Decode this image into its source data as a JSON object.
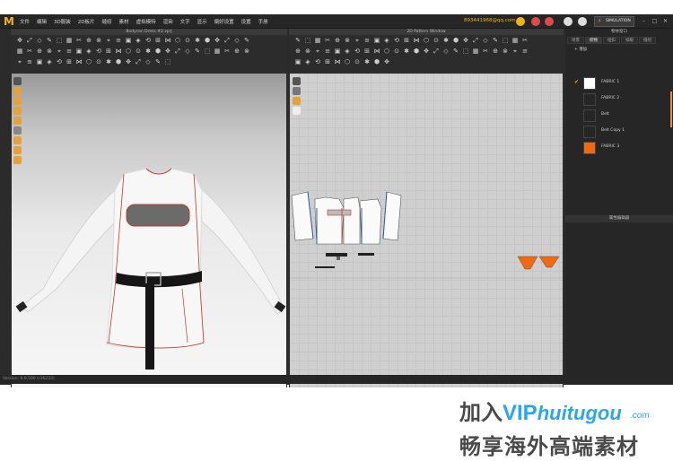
{
  "app": {
    "logo": "M",
    "menu": [
      "文件",
      "编辑",
      "3D服装",
      "2D板片",
      "缝纫",
      "素材",
      "虚拟模特",
      "渲染",
      "文字",
      "显示",
      "偏好设置",
      "设置",
      "手册"
    ],
    "account": "893441968@qq.com",
    "simulation_label": "SIMULATION"
  },
  "window3d": {
    "title": "Bodycon Dress #2.zprj"
  },
  "window2d": {
    "title": "2D Pattern Window"
  },
  "browser": {
    "title": "物体窗口",
    "tabs": [
      "场景",
      "织物",
      "纽扣",
      "扣眼",
      "缝纫"
    ],
    "active_tab": 1,
    "add_label": "+ 增加",
    "fabrics": [
      {
        "name": "FABRIC 1",
        "color": "#ffffff",
        "checked": true
      },
      {
        "name": "FABRIC 2",
        "color": "#262626",
        "checked": false
      },
      {
        "name": "Belt",
        "color": "#262626",
        "checked": false
      },
      {
        "name": "Belt Copy 1",
        "color": "#262626",
        "checked": false
      },
      {
        "name": "FABRIC 3",
        "color": "#f06a12",
        "checked": false
      }
    ],
    "properties_title": "属性编辑器"
  },
  "status": {
    "text": "Version: 6.0.500 (r36233)"
  },
  "watermark": {
    "line1_prefix": "加入",
    "line1_vip": "VIP",
    "line1_site": "huitugou",
    "line1_com": ".com",
    "line2": "畅享海外高端素材"
  },
  "colors": {
    "accent": "#f2b317",
    "seam": "#c0392b",
    "fabric3": "#f06a12"
  }
}
